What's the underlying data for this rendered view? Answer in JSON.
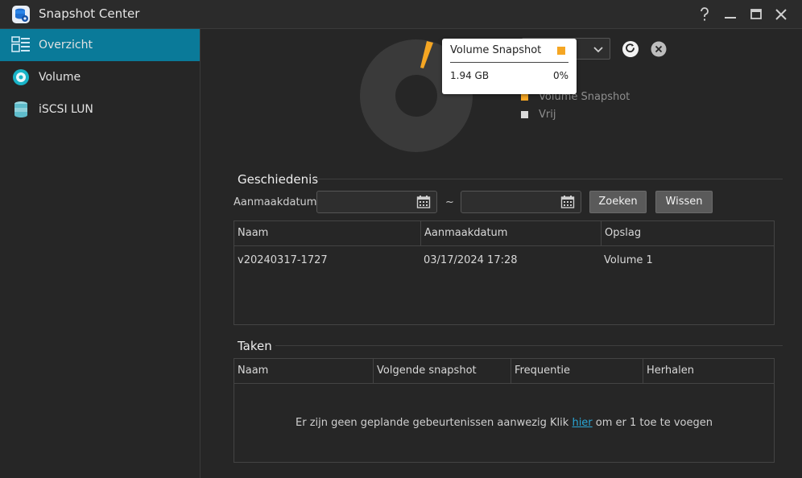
{
  "window": {
    "title": "Snapshot Center"
  },
  "sidebar": {
    "items": [
      {
        "label": "Overzicht",
        "icon": "overview-list-icon",
        "active": true
      },
      {
        "label": "Volume",
        "icon": "volume-disk-icon",
        "active": false
      },
      {
        "label": "iSCSI LUN",
        "icon": "database-stack-icon",
        "active": false
      }
    ]
  },
  "overview": {
    "legend": [
      {
        "label": "Volume Snapshot",
        "color": "#f5a623"
      },
      {
        "label": "Vrij",
        "color": "#d9d9d9"
      }
    ],
    "tooltip": {
      "title": "Volume Snapshot",
      "size": "1.94 GB",
      "percent": "0%",
      "color": "#f5a623"
    },
    "chart_data": {
      "type": "pie",
      "categories": [
        "Volume Snapshot",
        "Vrij"
      ],
      "values": [
        0,
        100
      ],
      "colors": [
        "#f5a623",
        "#3a3a3a"
      ]
    }
  },
  "history": {
    "title": "Geschiedenis",
    "filter_label": "Aanmaakdatum:",
    "separator": "~",
    "search_button": "Zoeken",
    "clear_button": "Wissen",
    "columns": [
      "Naam",
      "Aanmaakdatum",
      "Opslag"
    ],
    "rows": [
      {
        "name": "v20240317-1727",
        "created": "03/17/2024 17:28",
        "storage": "Volume 1"
      }
    ]
  },
  "tasks": {
    "title": "Taken",
    "columns": [
      "Naam",
      "Volgende snapshot",
      "Frequentie",
      "Herhalen"
    ],
    "empty_before": "Er zijn geen geplande gebeurtenissen aanwezig Klik",
    "empty_link": "hier",
    "empty_after": "om er 1 toe te voegen"
  },
  "colors": {
    "accent": "#0a7a99",
    "link": "#2aa7d6",
    "snapshot": "#f5a623"
  }
}
